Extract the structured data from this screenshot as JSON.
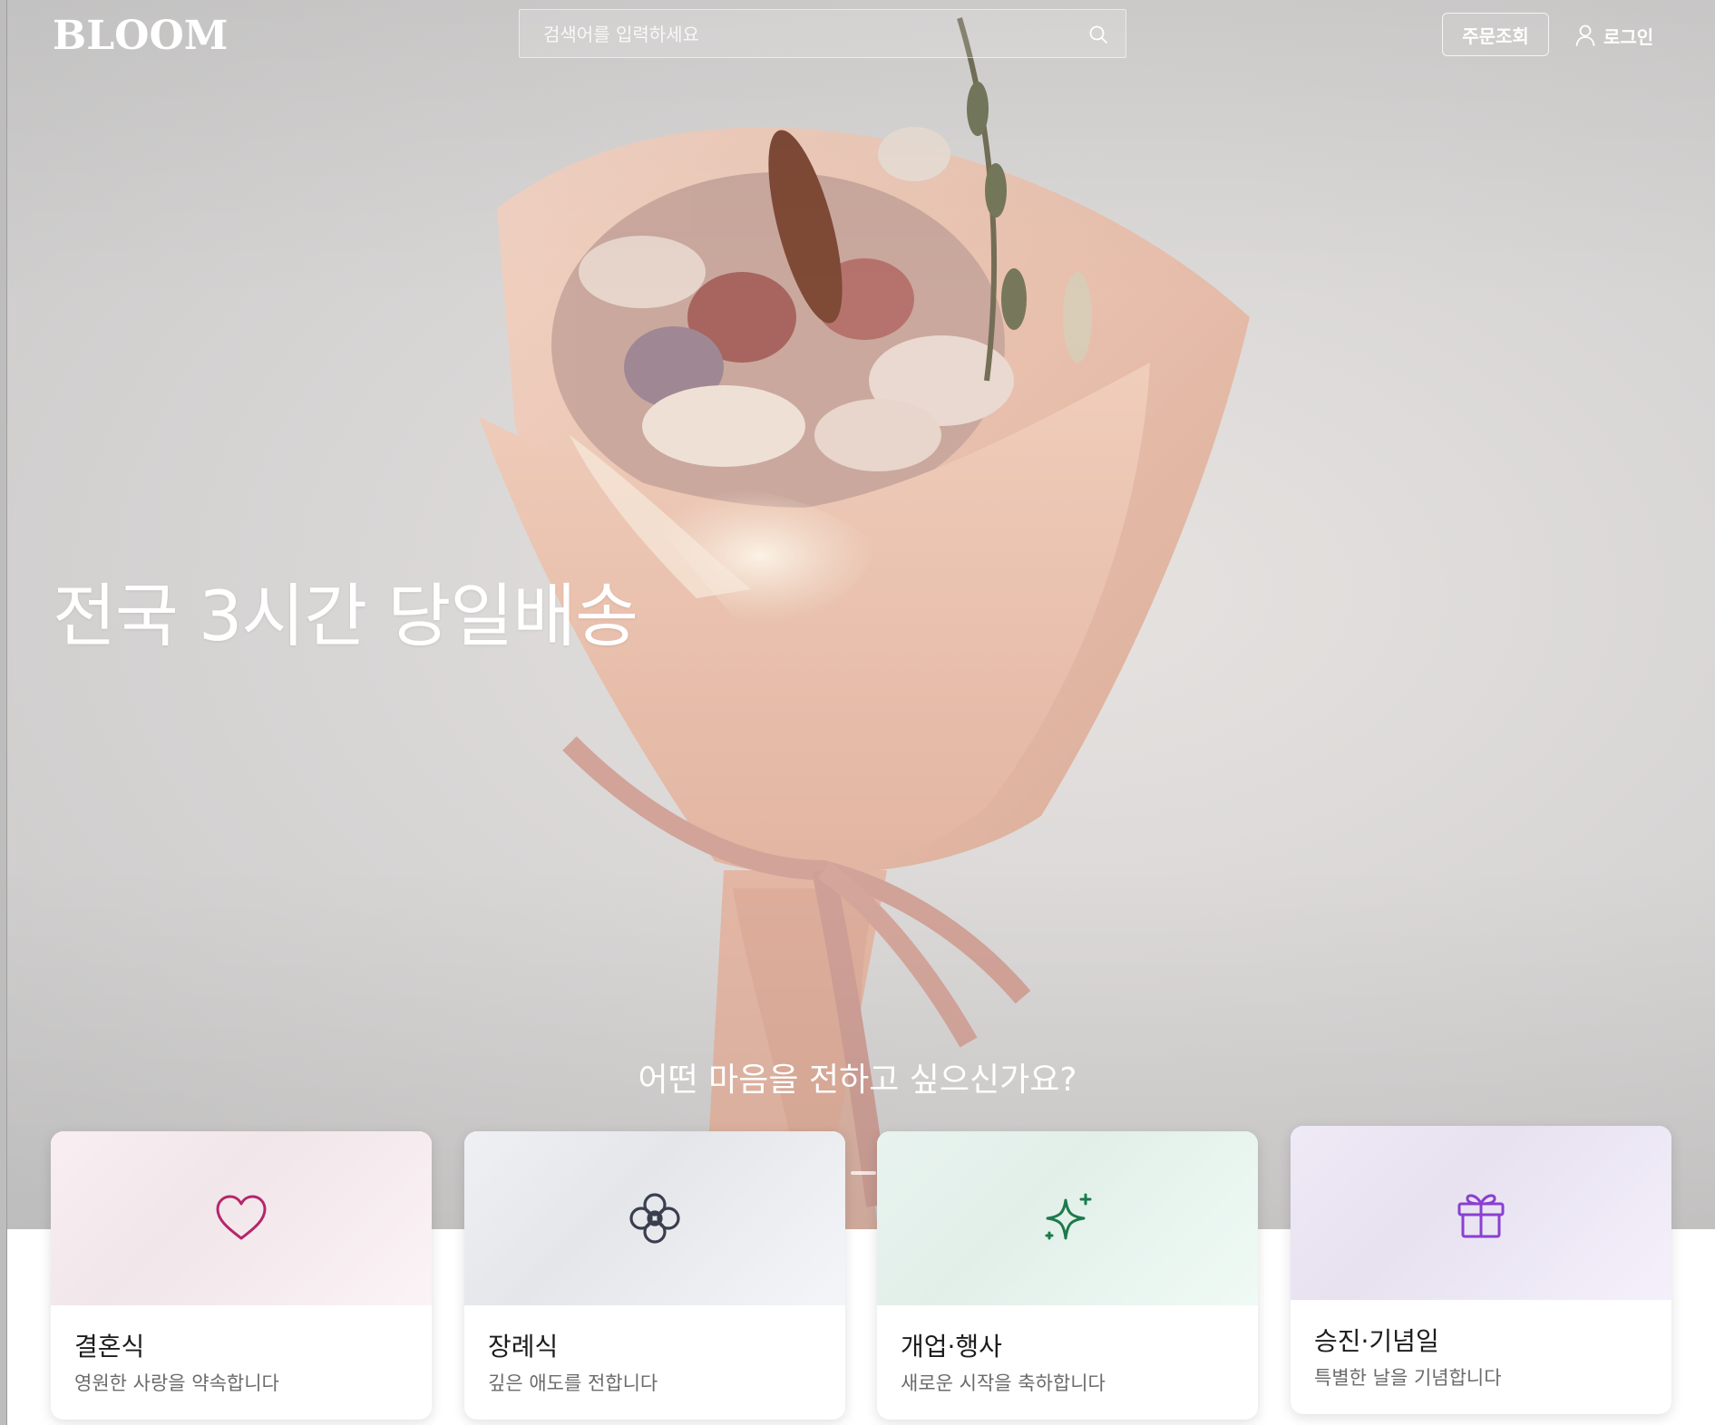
{
  "brand": {
    "logo": "BLOOM"
  },
  "search": {
    "placeholder": "검색어를 입력하세요",
    "icon": "search-icon"
  },
  "nav": {
    "order_lookup": "주문조회",
    "login": "로그인",
    "login_icon": "user-icon"
  },
  "hero": {
    "headline": "전국 3시간 당일배송",
    "question": "어떤 마음을 전하고 싶으신가요?"
  },
  "categories": [
    {
      "title": "결혼식",
      "description": "영원한 사랑을 약속합니다",
      "icon": "heart-icon",
      "accent": "#b5266b"
    },
    {
      "title": "장례식",
      "description": "깊은 애도를 전합니다",
      "icon": "flower-icon",
      "accent": "#3a3f4e"
    },
    {
      "title": "개업·행사",
      "description": "새로운 시작을 축하합니다",
      "icon": "sparkle-icon",
      "accent": "#1c7a4c"
    },
    {
      "title": "승진·기념일",
      "description": "특별한 날을 기념합니다",
      "icon": "gift-icon",
      "accent": "#8a3fd1"
    }
  ]
}
